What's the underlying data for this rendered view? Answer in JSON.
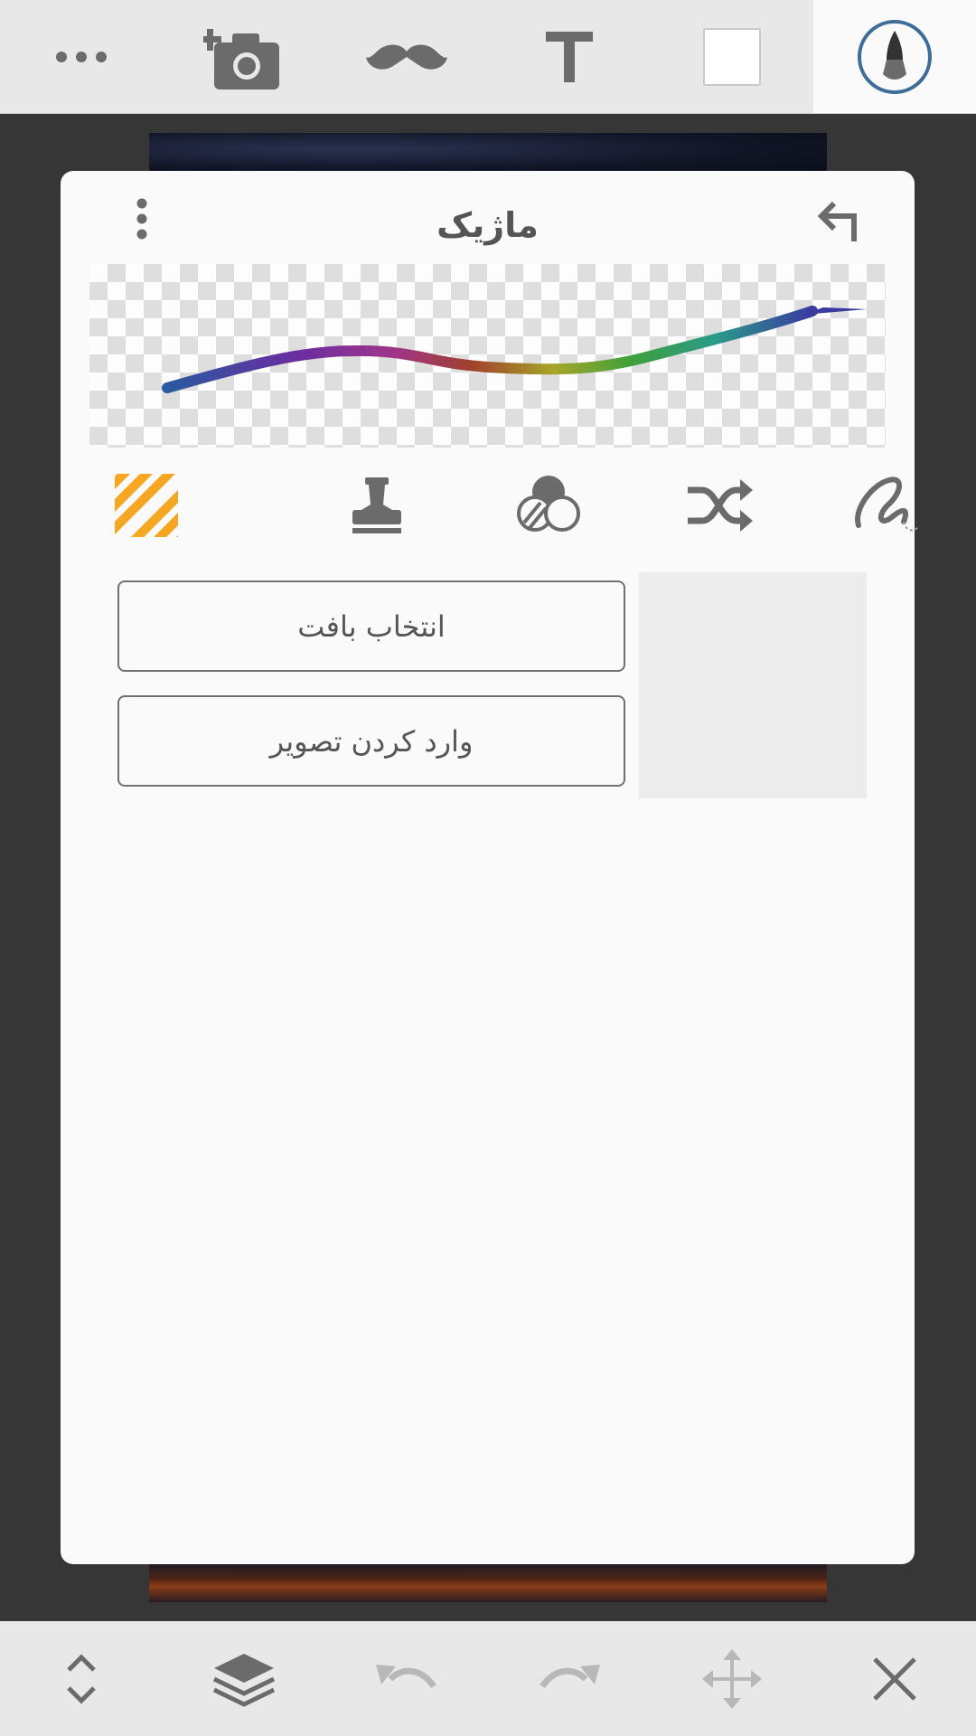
{
  "toolbar": {
    "items": [
      {
        "name": "more",
        "icon": "more-horizontal-icon"
      },
      {
        "name": "add-photo",
        "icon": "add-photo-camera-icon"
      },
      {
        "name": "sticker",
        "icon": "mustache-icon"
      },
      {
        "name": "text",
        "icon": "text-icon"
      },
      {
        "name": "color",
        "icon": "color-swatch-icon",
        "color": "#ffffff"
      },
      {
        "name": "brush",
        "icon": "brush-icon",
        "active": true
      }
    ]
  },
  "panel": {
    "title": "ماژیک",
    "menu_icon": "more-vertical-icon",
    "back_icon": "back-arrow-icon",
    "modes": [
      {
        "icon": "texture-stripes-icon",
        "active": true,
        "color": "#f5a623"
      },
      {
        "icon": "stamp-icon"
      },
      {
        "icon": "blend-circles-icon"
      },
      {
        "icon": "shuffle-icon"
      },
      {
        "icon": "scribble-icon"
      }
    ],
    "buttons": {
      "select_texture": "انتخاب بافت",
      "import_image": "وارد کردن تصویر"
    }
  },
  "bottombar": {
    "items": [
      {
        "icon": "expand-collapse-icon"
      },
      {
        "icon": "layers-icon"
      },
      {
        "icon": "undo-icon",
        "disabled": true
      },
      {
        "icon": "redo-icon",
        "disabled": true
      },
      {
        "icon": "move-icon",
        "disabled": true
      },
      {
        "icon": "close-icon"
      }
    ]
  },
  "colors": {
    "icon": "#6b6b6b",
    "icon_disabled": "#b8b8b8",
    "accent": "#f5a623",
    "active_ring": "#3d6d99"
  }
}
